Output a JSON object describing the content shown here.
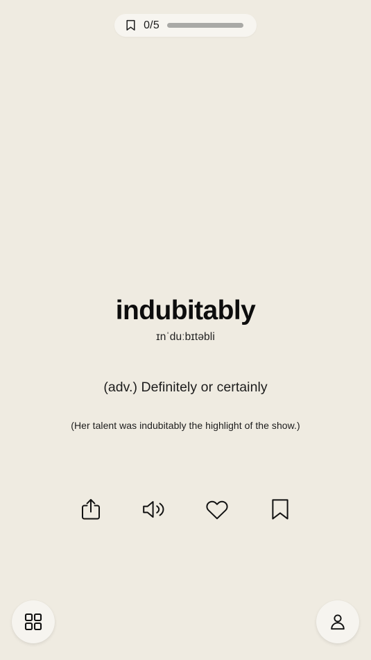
{
  "app": {
    "background_color": "#efebe1",
    "text_color": "#111111"
  },
  "topbar": {
    "bookmark_icon": "bookmark-icon",
    "count_label": "0/5",
    "saved": 0,
    "total": 5,
    "progress_percent": 0,
    "track_color": "#a9a9a6",
    "pill_color": "#f7f5f0"
  },
  "card": {
    "word": "indubitably",
    "phonetic": "ɪnˈduːbɪtəbli",
    "definition": "(adv.) Definitely or certainly",
    "example": "(Her talent was indubitably the highlight of the show.)"
  },
  "actions": [
    {
      "name": "share-button",
      "icon": "share-icon",
      "label": "Share"
    },
    {
      "name": "pronounce-button",
      "icon": "speaker-icon",
      "label": "Pronounce"
    },
    {
      "name": "favorite-button",
      "icon": "heart-icon",
      "label": "Favorite"
    },
    {
      "name": "bookmark-button",
      "icon": "bookmark-icon",
      "label": "Bookmark"
    }
  ],
  "bottom": {
    "grid_button": {
      "name": "grid-button",
      "icon": "grid-icon",
      "label": "Browse"
    },
    "profile_button": {
      "name": "profile-button",
      "icon": "person-icon",
      "label": "Profile"
    }
  }
}
